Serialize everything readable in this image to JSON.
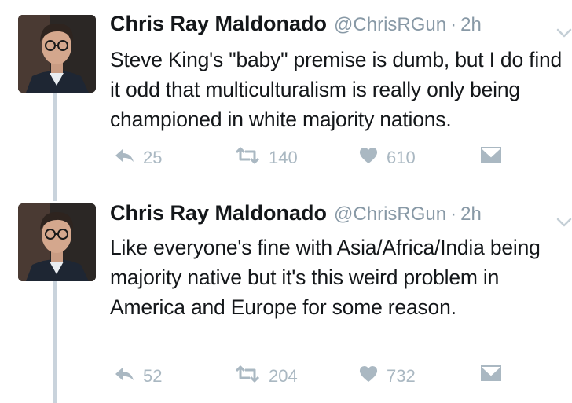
{
  "tweets": [
    {
      "author_name": "Chris Ray Maldonado",
      "handle": "@ChrisRGun",
      "separator": "·",
      "time": "2h",
      "text": "Steve King's \"baby\" premise is dumb, but I do find it odd that multiculturalism is really only being championed in white majority nations.",
      "replies": "25",
      "retweets": "140",
      "likes": "610"
    },
    {
      "author_name": "Chris Ray Maldonado",
      "handle": "@ChrisRGun",
      "separator": "·",
      "time": "2h",
      "text": "Like everyone's fine with Asia/Africa/India being majority native but it's this weird problem in America and Europe for some reason.",
      "replies": "52",
      "retweets": "204",
      "likes": "732"
    }
  ],
  "icons": {
    "reply": "reply-icon",
    "retweet": "retweet-icon",
    "like": "heart-icon",
    "message": "direct-message-icon",
    "more": "chevron-down-icon"
  },
  "colors": {
    "text": "#14171a",
    "secondary": "#8899a6",
    "action": "#aab8c2",
    "thread_line": "#c9d3dc"
  }
}
